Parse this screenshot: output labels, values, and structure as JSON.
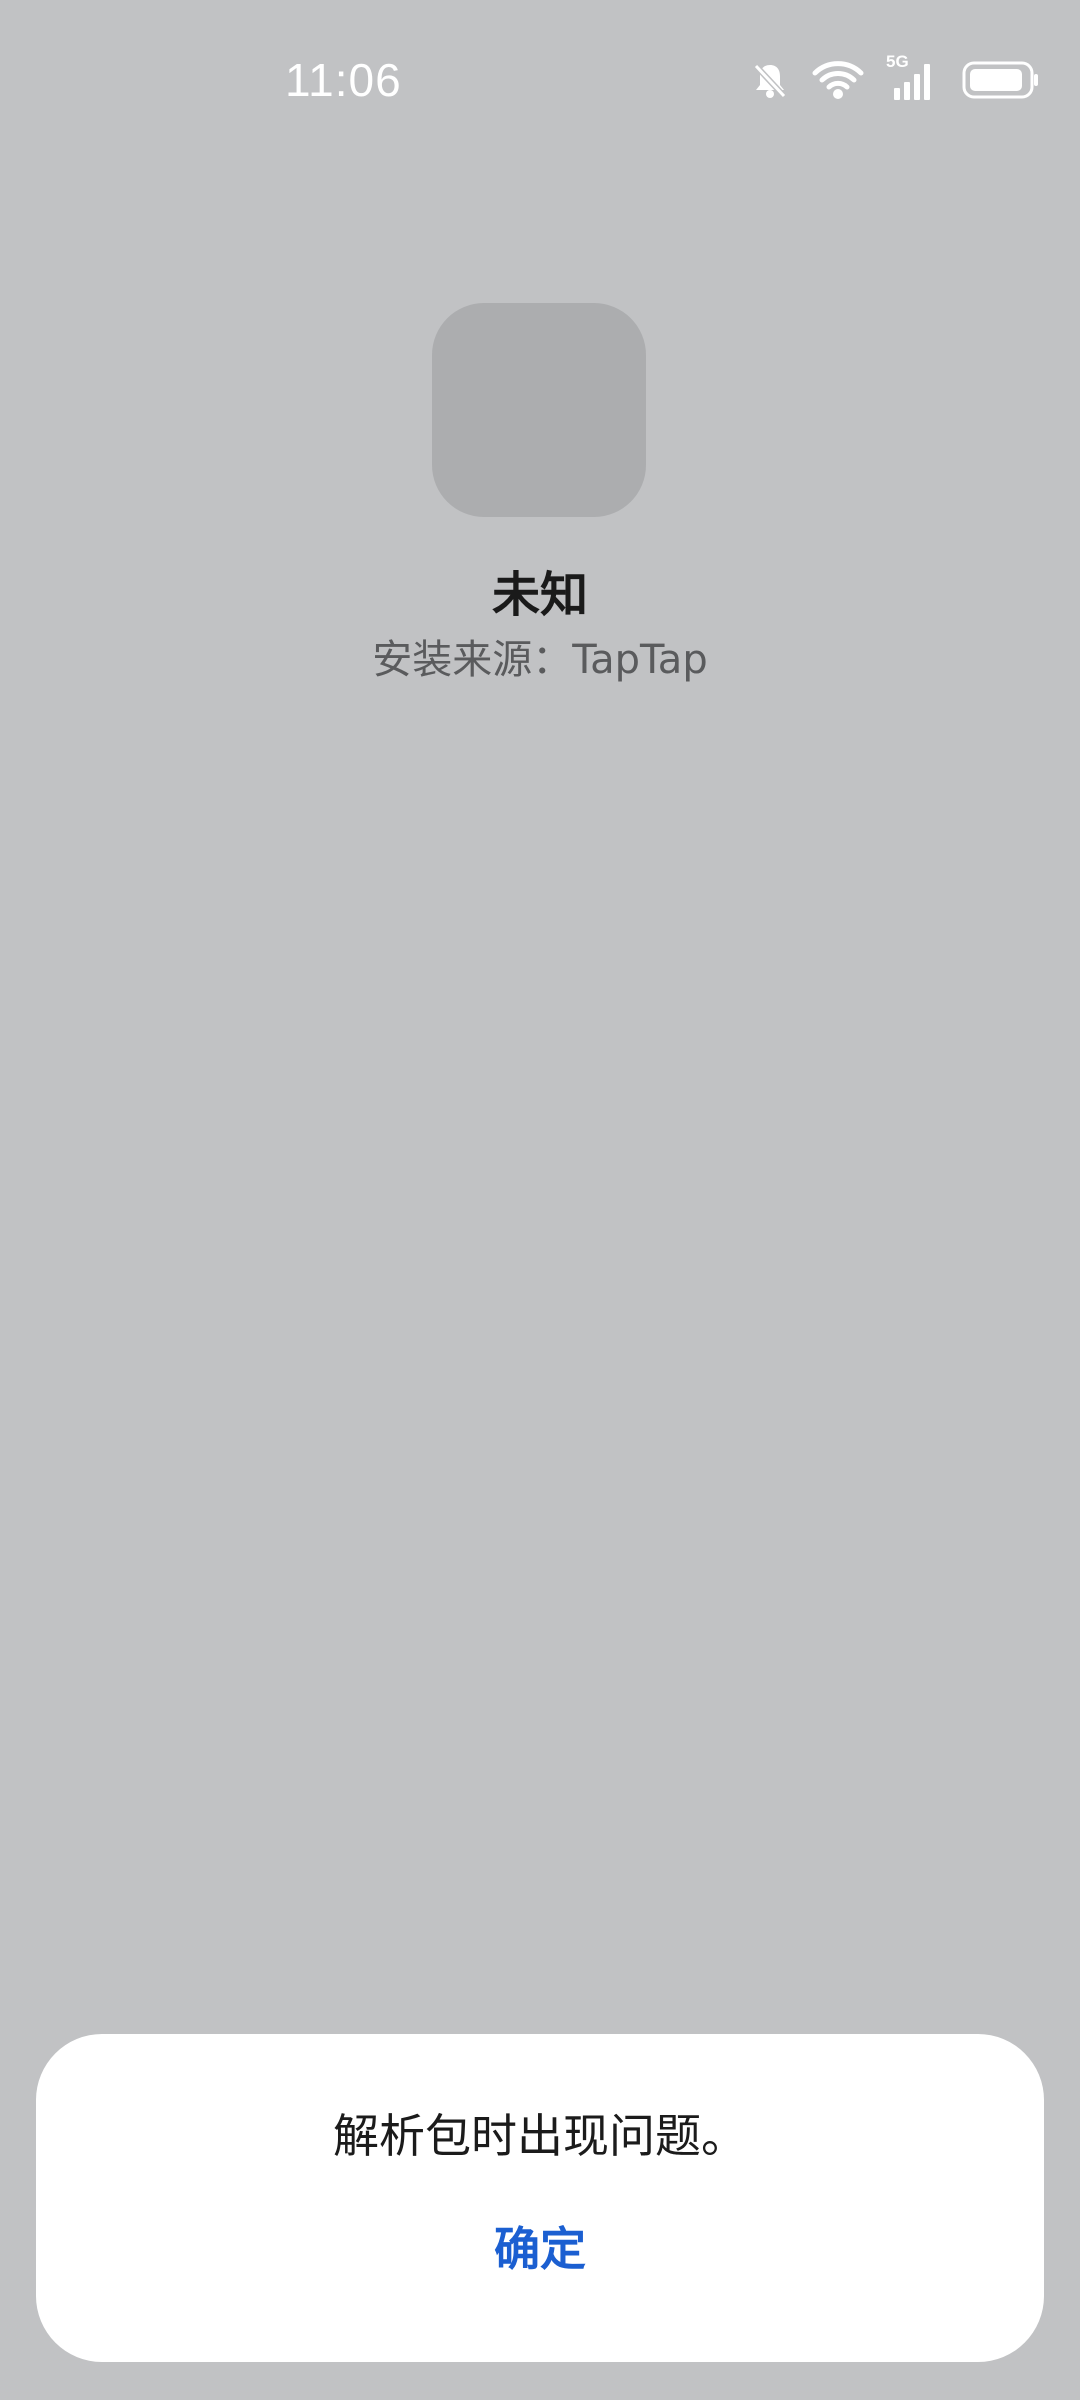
{
  "status_bar": {
    "time": "11:06",
    "network_label": "5G",
    "icons": [
      "notifications-muted-icon",
      "wifi-icon",
      "cellular-signal-icon",
      "battery-icon"
    ]
  },
  "app": {
    "name": "未知",
    "install_source": "安装来源：TapTap"
  },
  "dialog": {
    "message": "解析包时出现问题。",
    "confirm_label": "确定"
  },
  "colors": {
    "background": "#c1c2c4",
    "icon_placeholder": "#acadaf",
    "dialog_background": "#ffffff",
    "accent": "#1b5fd1"
  }
}
